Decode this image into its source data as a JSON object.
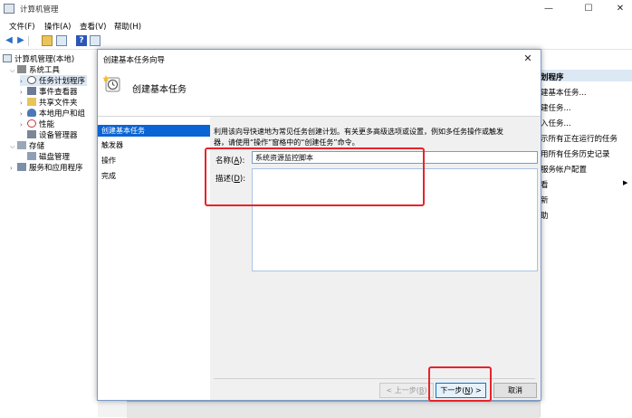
{
  "window": {
    "title": "计算机管理",
    "minimize": "—",
    "maximize": "☐",
    "close": "✕"
  },
  "menubar": {
    "file": "文件(F)",
    "action": "操作(A)",
    "view": "查看(V)",
    "help": "帮助(H)"
  },
  "toolbar": {
    "back": "◀",
    "forward": "▶",
    "help": "?"
  },
  "tree": {
    "root": "计算机管理(本地)",
    "system_tools": "系统工具",
    "task_scheduler": "任务计划程序",
    "event_viewer": "事件查看器",
    "shared_folders": "共享文件夹",
    "local_users": "本地用户和组",
    "performance": "性能",
    "device_manager": "设备管理器",
    "storage": "存储",
    "disk_management": "磁盘管理",
    "services_apps": "服务和应用程序"
  },
  "right_panel": {
    "header": "划程序",
    "items": [
      "建基本任务...",
      "建任务...",
      "入任务...",
      "示所有正在运行的任务",
      "用所有任务历史记录",
      "服务帐户配置",
      "看",
      "新",
      "助"
    ],
    "submenu_arrow": "▶"
  },
  "dialog": {
    "title": "创建基本任务向导",
    "heading": "创建基本任务",
    "close": "✕",
    "steps": [
      "创建基本任务",
      "触发器",
      "操作",
      "完成"
    ],
    "description_line1": "利用该向导快速地为常见任务创建计划。有关更多高级选项或设置，例如多任务操作或触发",
    "description_line2": "器，请使用“操作”窗格中的“创建任务”命令。",
    "name_label": "名称(",
    "name_key": "A",
    "name_suffix": "):",
    "name_value": "系统资源监控脚本",
    "desc_label": "描述(",
    "desc_key": "D",
    "desc_suffix": "):",
    "desc_value": "",
    "btn_prev_prefix": "< 上一步(",
    "btn_prev_key": "B",
    "btn_prev_suffix": ")",
    "btn_next_prefix": "下一步(",
    "btn_next_key": "N",
    "btn_next_suffix": ") >",
    "btn_cancel": "取消"
  },
  "colors": {
    "accent": "#0a64d3",
    "highlight": "#e8232a"
  }
}
